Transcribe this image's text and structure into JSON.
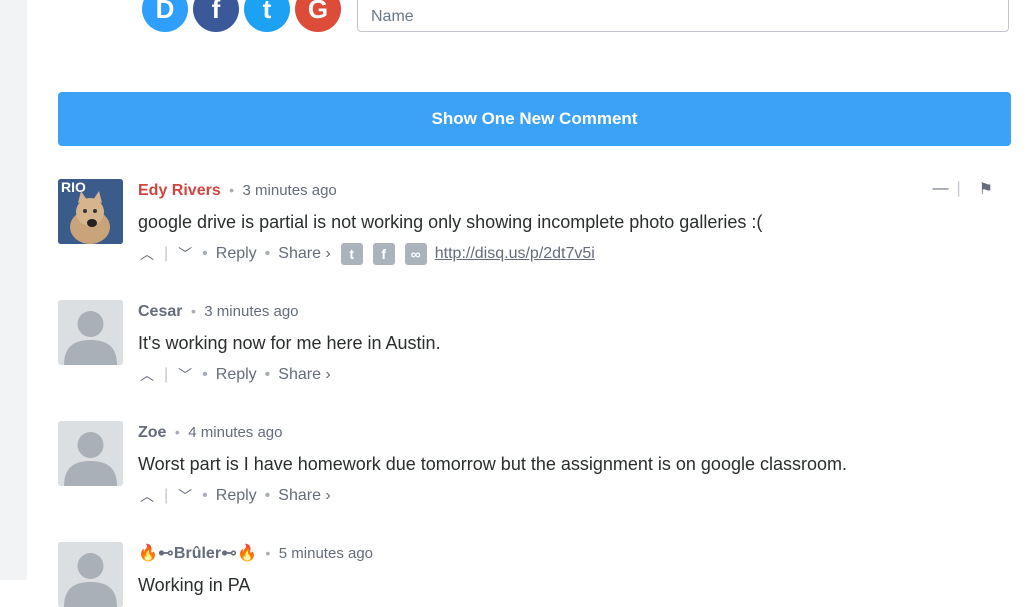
{
  "login": {
    "icons": [
      {
        "name": "disqus-icon",
        "glyph": "D"
      },
      {
        "name": "facebook-icon",
        "glyph": "f"
      },
      {
        "name": "twitter-icon",
        "glyph": "t"
      },
      {
        "name": "google-icon",
        "glyph": "G"
      }
    ],
    "name_placeholder": "Name"
  },
  "new_comments_button": "Show One New Comment",
  "comments": [
    {
      "author": "Edy Rivers",
      "time": "3 minutes ago",
      "message": "google drive is partial is not working only showing incomplete photo galleries :(",
      "reply": "Reply",
      "share": "Share ›",
      "permalink": "http://disq.us/p/2dt7v5i",
      "avatar_text": "RIO"
    },
    {
      "author": "Cesar",
      "time": "3 minutes ago",
      "message": "It's working now for me here in Austin.",
      "reply": "Reply",
      "share": "Share ›"
    },
    {
      "author": "Zoe",
      "time": "4 minutes ago",
      "message": "Worst part is I have homework due tomorrow but the assignment is on google classroom.",
      "reply": "Reply",
      "share": "Share ›"
    },
    {
      "author": "🔥⊷Brûler⊷🔥",
      "time": "5 minutes ago",
      "message": "Working in PA"
    }
  ],
  "colors": {
    "accent": "#3ca2f7",
    "highlight_author": "#d04540",
    "muted": "#656c7a"
  }
}
